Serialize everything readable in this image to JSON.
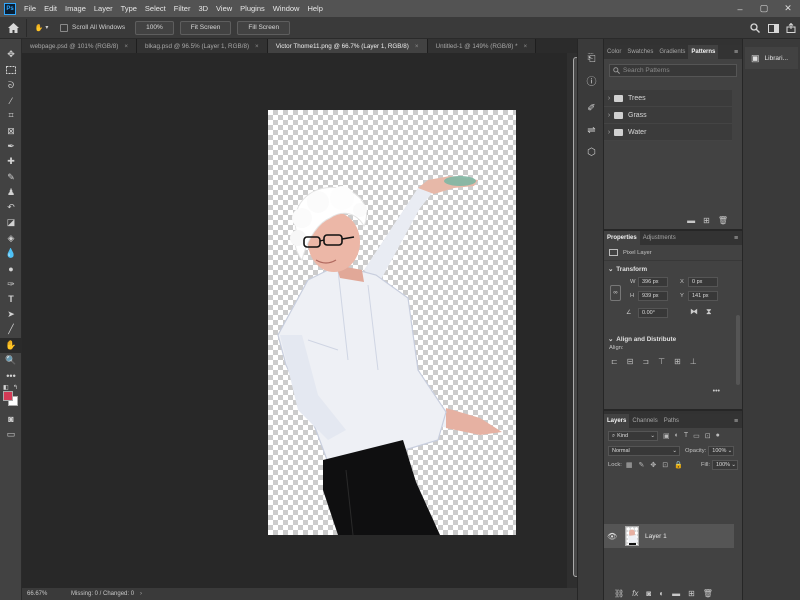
{
  "app": {
    "logo": "Ps"
  },
  "menubar": {
    "items": [
      "File",
      "Edit",
      "Image",
      "Layer",
      "Type",
      "Select",
      "Filter",
      "3D",
      "View",
      "Plugins",
      "Window",
      "Help"
    ]
  },
  "options": {
    "scroll_all_windows": "Scroll All Windows",
    "zoom_100": "100%",
    "fit_screen": "Fit Screen",
    "fill_screen": "Fill Screen"
  },
  "tabs": [
    {
      "label": "webpage.psd @ 101% (RGB/8)"
    },
    {
      "label": "blkag.psd @ 96.5% (Layer 1, RGB/8)"
    },
    {
      "label": "Victor Thome11.png @ 66.7% (Layer 1, RGB/8)"
    },
    {
      "label": "Untitled-1 @ 149% (RGB/8) *"
    }
  ],
  "status": {
    "zoom": "66.67%",
    "info": "Missing: 0 / Changed: 0"
  },
  "patterns_panel": {
    "tabs": [
      "Color",
      "Swatches",
      "Gradients",
      "Patterns"
    ],
    "search_placeholder": "Search Patterns",
    "folders": [
      "Trees",
      "Grass",
      "Water"
    ]
  },
  "properties_panel": {
    "tabs": [
      "Properties",
      "Adjustments"
    ],
    "layer_type": "Pixel Layer",
    "transform_title": "Transform",
    "w_label": "W",
    "w_value": "396 px",
    "h_label": "H",
    "h_value": "939 px",
    "x_label": "X",
    "x_value": "0 px",
    "y_label": "Y",
    "y_value": "141 px",
    "angle_value": "0.00°",
    "align_title": "Align and Distribute",
    "align_label": "Align:"
  },
  "layers_panel": {
    "tabs": [
      "Layers",
      "Channels",
      "Paths"
    ],
    "kind": "Kind",
    "blend_mode": "Normal",
    "opacity_label": "Opacity:",
    "opacity_value": "100%",
    "lock_label": "Lock:",
    "fill_label": "Fill:",
    "fill_value": "100%",
    "layer_name": "Layer 1"
  },
  "libraries": {
    "label": "Librari..."
  },
  "colors": {
    "foreground": "#d43b56",
    "background": "#ffffff",
    "accent": "#31a8ff"
  }
}
